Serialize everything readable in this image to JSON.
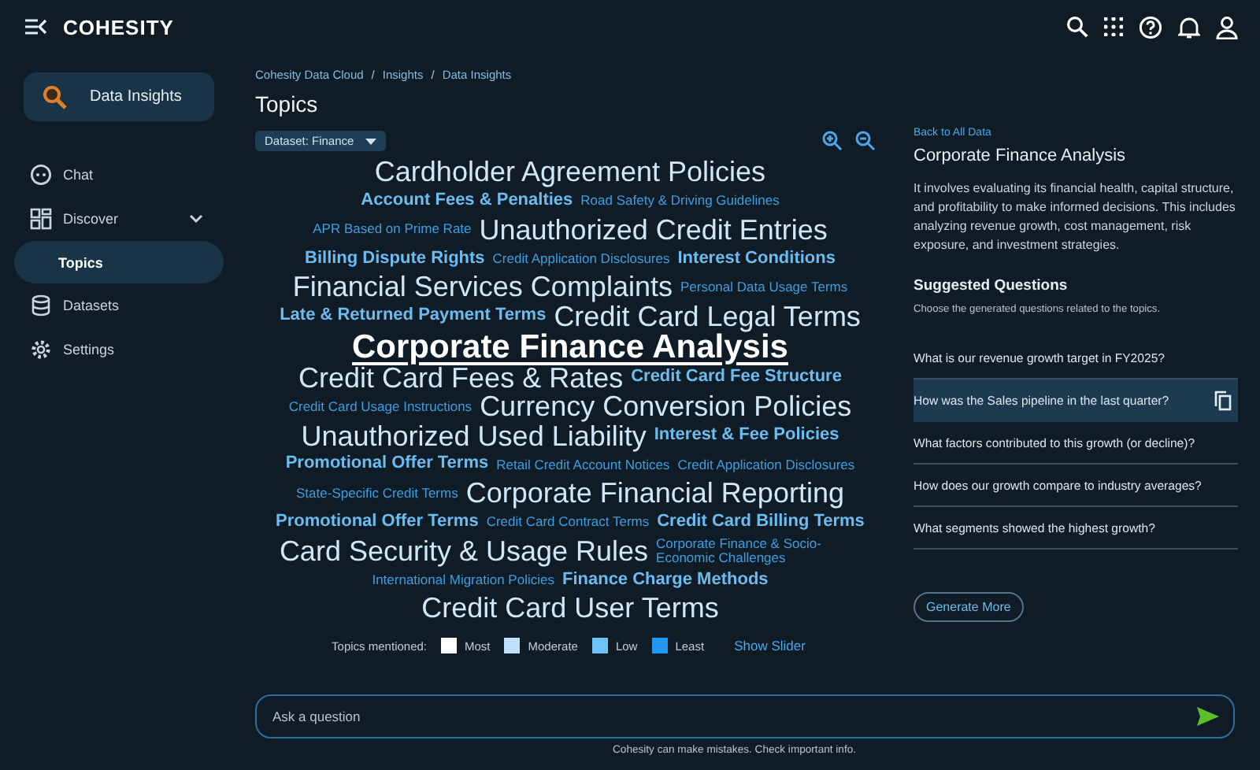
{
  "header": {
    "logo": "COHESITY"
  },
  "sidebar": {
    "app_card": {
      "label": "Data Insights"
    },
    "items": [
      {
        "label": "Chat",
        "kind": "chat",
        "selected": false
      },
      {
        "label": "Discover",
        "kind": "discover",
        "selected": false,
        "expanded": true,
        "children": [
          {
            "label": "Topics",
            "selected": true
          }
        ]
      },
      {
        "label": "Datasets",
        "kind": "datasets",
        "selected": false
      },
      {
        "label": "Settings",
        "kind": "settings",
        "selected": false
      }
    ]
  },
  "breadcrumb": [
    {
      "kind": "link",
      "text": "Cohesity Data Cloud"
    },
    {
      "kind": "separator",
      "text": "/"
    },
    {
      "kind": "link",
      "text": "Insights"
    },
    {
      "kind": "separator",
      "text": "/"
    },
    {
      "kind": "link",
      "text": "Data Insights"
    }
  ],
  "page_title": "Topics",
  "dataset_select": {
    "value": "Dataset: Finance"
  },
  "topic_cloud": {
    "rows": [
      [
        {
          "label": "Cardholder Agreement Policies",
          "kind": "large",
          "color": "#cfe7f8",
          "selected": false
        }
      ],
      [
        {
          "label": "Account Fees & Penalties",
          "kind": "medium",
          "color": "#6cbcf0",
          "selected": false
        },
        {
          "label": "Road Safety & Driving Guidelines",
          "kind": "small",
          "color": "#3d9ee0",
          "selected": false
        }
      ],
      [
        {
          "label": "APR Based on Prime Rate",
          "kind": "small",
          "color": "#3d9ee0",
          "selected": false
        },
        {
          "label": "Unauthorized Credit Entries",
          "kind": "large",
          "color": "#cfe7f8",
          "selected": false
        }
      ],
      [
        {
          "label": "Billing Dispute Rights",
          "kind": "medium",
          "color": "#6cbcf0",
          "selected": false
        },
        {
          "label": "Credit Application Disclosures",
          "kind": "small",
          "color": "#3d9ee0",
          "selected": false
        },
        {
          "label": "Interest Conditions",
          "kind": "medium",
          "color": "#6cbcf0",
          "selected": false
        }
      ],
      [
        {
          "label": "Financial Services Complaints",
          "kind": "large",
          "color": "#cfe7f8",
          "selected": false
        },
        {
          "label": "Personal Data Usage Terms",
          "kind": "small",
          "color": "#3d9ee0",
          "selected": false
        }
      ],
      [
        {
          "label": "Late & Returned Payment Terms",
          "kind": "medium",
          "color": "#6cbcf0",
          "selected": false
        },
        {
          "label": "Credit Card Legal Terms",
          "kind": "large",
          "color": "#cfe7f8",
          "selected": false
        }
      ],
      [
        {
          "label": "Corporate Finance Analysis",
          "kind": "large",
          "color": "#ffffff",
          "selected": true
        }
      ],
      [
        {
          "label": "Credit Card Fees & Rates",
          "kind": "large",
          "color": "#cfe7f8",
          "selected": false
        },
        {
          "label": "Credit Card Fee Structure",
          "kind": "medium",
          "color": "#6cbcf0",
          "selected": false
        }
      ],
      [
        {
          "label": "Credit Card Usage Instructions",
          "kind": "small",
          "color": "#3d9ee0",
          "selected": false
        },
        {
          "label": "Currency Conversion Policies",
          "kind": "large",
          "color": "#cfe7f8",
          "selected": false
        }
      ],
      [
        {
          "label": "Unauthorized Used Liability",
          "kind": "large",
          "color": "#cfe7f8",
          "selected": false
        },
        {
          "label": "Interest & Fee Policies",
          "kind": "medium",
          "color": "#6cbcf0",
          "selected": false
        }
      ],
      [
        {
          "label": "Promotional Offer Terms",
          "kind": "medium",
          "color": "#6cbcf0",
          "selected": false
        },
        {
          "label": "Retail Credit Account Notices",
          "kind": "small",
          "color": "#3d9ee0",
          "selected": false
        },
        {
          "label": "Credit Application Disclosures",
          "kind": "small",
          "color": "#3d9ee0",
          "selected": false
        }
      ],
      [
        {
          "label": "State-Specific Credit Terms",
          "kind": "small",
          "color": "#3d9ee0",
          "selected": false
        },
        {
          "label": "Corporate Financial Reporting",
          "kind": "large",
          "color": "#cfe7f8",
          "selected": false
        }
      ],
      [
        {
          "label": "Promotional Offer Terms",
          "kind": "medium",
          "color": "#6cbcf0",
          "selected": false
        },
        {
          "label": "Credit Card Contract Terms",
          "kind": "small",
          "color": "#3d9ee0",
          "selected": false
        },
        {
          "label": "Credit Card Billing Terms",
          "kind": "medium",
          "color": "#6cbcf0",
          "selected": false
        }
      ],
      [
        {
          "label": "Card Security & Usage Rules",
          "kind": "large",
          "color": "#cfe7f8",
          "selected": false
        },
        {
          "label": "Corporate Finance & Socio-Economic Challenges",
          "kind": "small",
          "color": "#3d9ee0",
          "selected": false
        }
      ],
      [
        {
          "label": "International Migration Policies",
          "kind": "small",
          "color": "#3d9ee0",
          "selected": false
        },
        {
          "label": "Finance Charge Methods",
          "kind": "medium",
          "color": "#6cbcf0",
          "selected": false
        }
      ],
      [
        {
          "label": "Credit Card User Terms",
          "kind": "large",
          "color": "#cfe7f8",
          "selected": false
        }
      ]
    ]
  },
  "legend": {
    "label": "Topics mentioned:",
    "items": [
      {
        "label": "Most",
        "color": "#ffffff"
      },
      {
        "label": "Moderate",
        "color": "#bfe0fa"
      },
      {
        "label": "Low",
        "color": "#6cc3f5"
      },
      {
        "label": "Least",
        "color": "#2196f3"
      }
    ],
    "link": "Show Slider"
  },
  "details": {
    "back_link": "Back to All Data",
    "title": "Corporate Finance Analysis",
    "description": "It involves evaluating its financial health, capital structure, and profitability to make informed decisions. This includes analyzing revenue growth, cost management, risk exposure, and investment strategies.",
    "questions_title": "Suggested Questions",
    "questions_hint": "Choose the generated questions related to the topics.",
    "questions": [
      {
        "text": "What is our revenue growth target in FY2025?",
        "selected": false
      },
      {
        "text": "How was the Sales pipeline in the last quarter?",
        "selected": true
      },
      {
        "text": "What factors contributed to this growth (or decline)?",
        "selected": false
      },
      {
        "text": "How does our growth compare to industry averages?",
        "selected": false
      },
      {
        "text": "What segments showed the highest growth?",
        "selected": false
      }
    ],
    "button": "Generate More"
  },
  "chat_input": {
    "placeholder": "Ask a question"
  },
  "disclaimer": "Cohesity can make mistakes. Check important info."
}
